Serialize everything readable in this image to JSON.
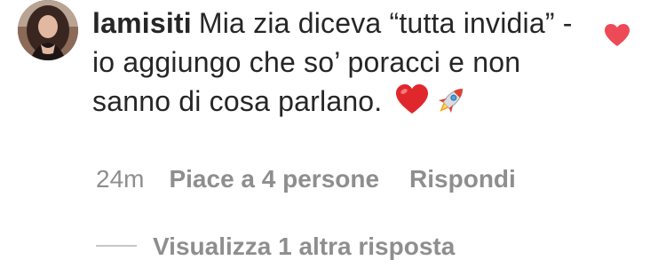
{
  "comment": {
    "username": "lamisiti",
    "text": "Mia zia diceva “tutta invidia” - io aggiungo che so’ poracci e non sanno di cosa parlano.",
    "emojis": [
      "heart-emoji",
      "rocket-emoji"
    ],
    "liked": true,
    "like_color": "#ed4956"
  },
  "meta": {
    "time": "24m",
    "likes": "Piace a 4 persone",
    "reply": "Rispondi"
  },
  "replies": {
    "label": "Visualizza 1 altra risposta"
  }
}
